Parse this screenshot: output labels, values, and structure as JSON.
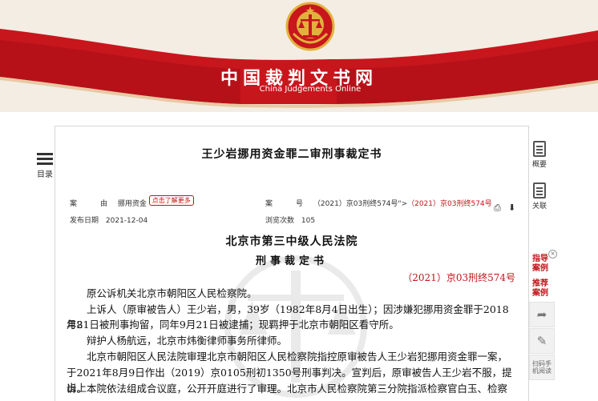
{
  "header": {
    "site_title": "中国裁判文书网",
    "site_subtitle": "China Judgements Online",
    "colors": {
      "brand_red": "#c0141a",
      "band_bg": "#f3ede3"
    }
  },
  "left_rail": {
    "toc_icon": "list-icon",
    "toc_label": "目录"
  },
  "document": {
    "title": "王少岩挪用资金罪二审刑事裁定书",
    "meta": {
      "cause_key": "案　由",
      "cause_value": "挪用资金",
      "cause_tip": "点击了解更多",
      "case_key": "案　号",
      "case_value_plain": "（2021）京03刑终574号\">",
      "case_value_red": "（2021）京03刑终574号",
      "publish_key": "发布日期",
      "publish_value": "2021-12-04",
      "views_key": "浏览次数",
      "views_value": "105"
    },
    "toolbar_icons": [
      "print-icon",
      "download-icon"
    ],
    "court_name": "北京市第三中级人民法院",
    "doc_kind": "刑事裁定书",
    "case_number": "（2021）京03刑终574号",
    "paragraphs": {
      "p1": "原公诉机关北京市朝阳区人民检察院。",
      "p2a": "上诉人（原审被告人）王少岩，男，39岁（1982年8月4日出生）；因涉嫌犯挪用资金罪于2018年8",
      "p2b": "月21日被刑事拘留，同年9月21日被逮捕；现羁押于北京市朝阳区看守所。",
      "p3": "辩护人杨航远，北京市炜衡律师事务所律师。",
      "p4a": "北京市朝阳区人民法院审理北京市朝阳区人民检察院指控原审被告人王少岩犯挪用资金罪一案，",
      "p4b": "于2021年8月9日作出（2019）京0105刑初1350号刑事判决。宣判后，原审被告人王少岩不服，提出上",
      "p4c": "诉。本院依法组成合议庭，公开开庭进行了审理。北京市人民检察院第三分院指派检察官白玉、检察"
    }
  },
  "right_rail": {
    "summary_label": "概要",
    "related_label": "关联",
    "guide_case": "指导案例",
    "recommend_case": "推荐案例",
    "close_glyph": "×",
    "share_icon": "share-icon",
    "edit_icon": "edit-icon",
    "scan_label": "扫码手机阅读"
  }
}
